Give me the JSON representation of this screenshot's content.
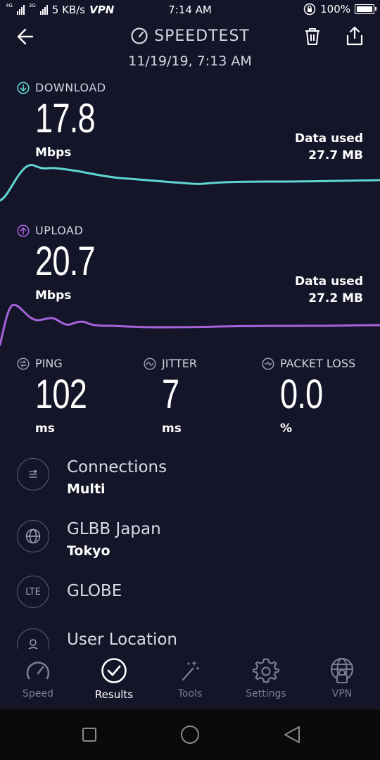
{
  "status_bar": {
    "network_1": "4G",
    "network_2": "3G",
    "speed": "5 KB/s",
    "vpn": "VPN",
    "time": "7:14 AM",
    "battery": "100%"
  },
  "header": {
    "title": "SPEEDTEST",
    "date": "11/19/19, 7:13 AM"
  },
  "download": {
    "label": "DOWNLOAD",
    "value": "17.8",
    "unit": "Mbps",
    "data_used_label": "Data used",
    "data_used": "27.7 MB",
    "color": "#5fd6d0"
  },
  "upload": {
    "label": "UPLOAD",
    "value": "20.7",
    "unit": "Mbps",
    "data_used_label": "Data used",
    "data_used": "27.2 MB",
    "color": "#a463d9"
  },
  "metrics": {
    "ping": {
      "label": "PING",
      "value": "102",
      "unit": "ms"
    },
    "jitter": {
      "label": "JITTER",
      "value": "7",
      "unit": "ms"
    },
    "packet_loss": {
      "label": "PACKET LOSS",
      "value": "0.0",
      "unit": "%"
    }
  },
  "details": [
    {
      "icon": "connections-icon",
      "title": "Connections",
      "sub": "Multi"
    },
    {
      "icon": "globe-icon",
      "title": "GLBB Japan",
      "sub": "Tokyo"
    },
    {
      "icon": "lte-icon",
      "icon_text": "LTE",
      "title": "GLOBE",
      "sub": ""
    },
    {
      "icon": "user-location-icon",
      "title": "User Location",
      "sub": ""
    }
  ],
  "tabs": [
    {
      "label": "Speed",
      "active": false
    },
    {
      "label": "Results",
      "active": true
    },
    {
      "label": "Tools",
      "active": false
    },
    {
      "label": "Settings",
      "active": false
    },
    {
      "label": "VPN",
      "active": false
    }
  ]
}
